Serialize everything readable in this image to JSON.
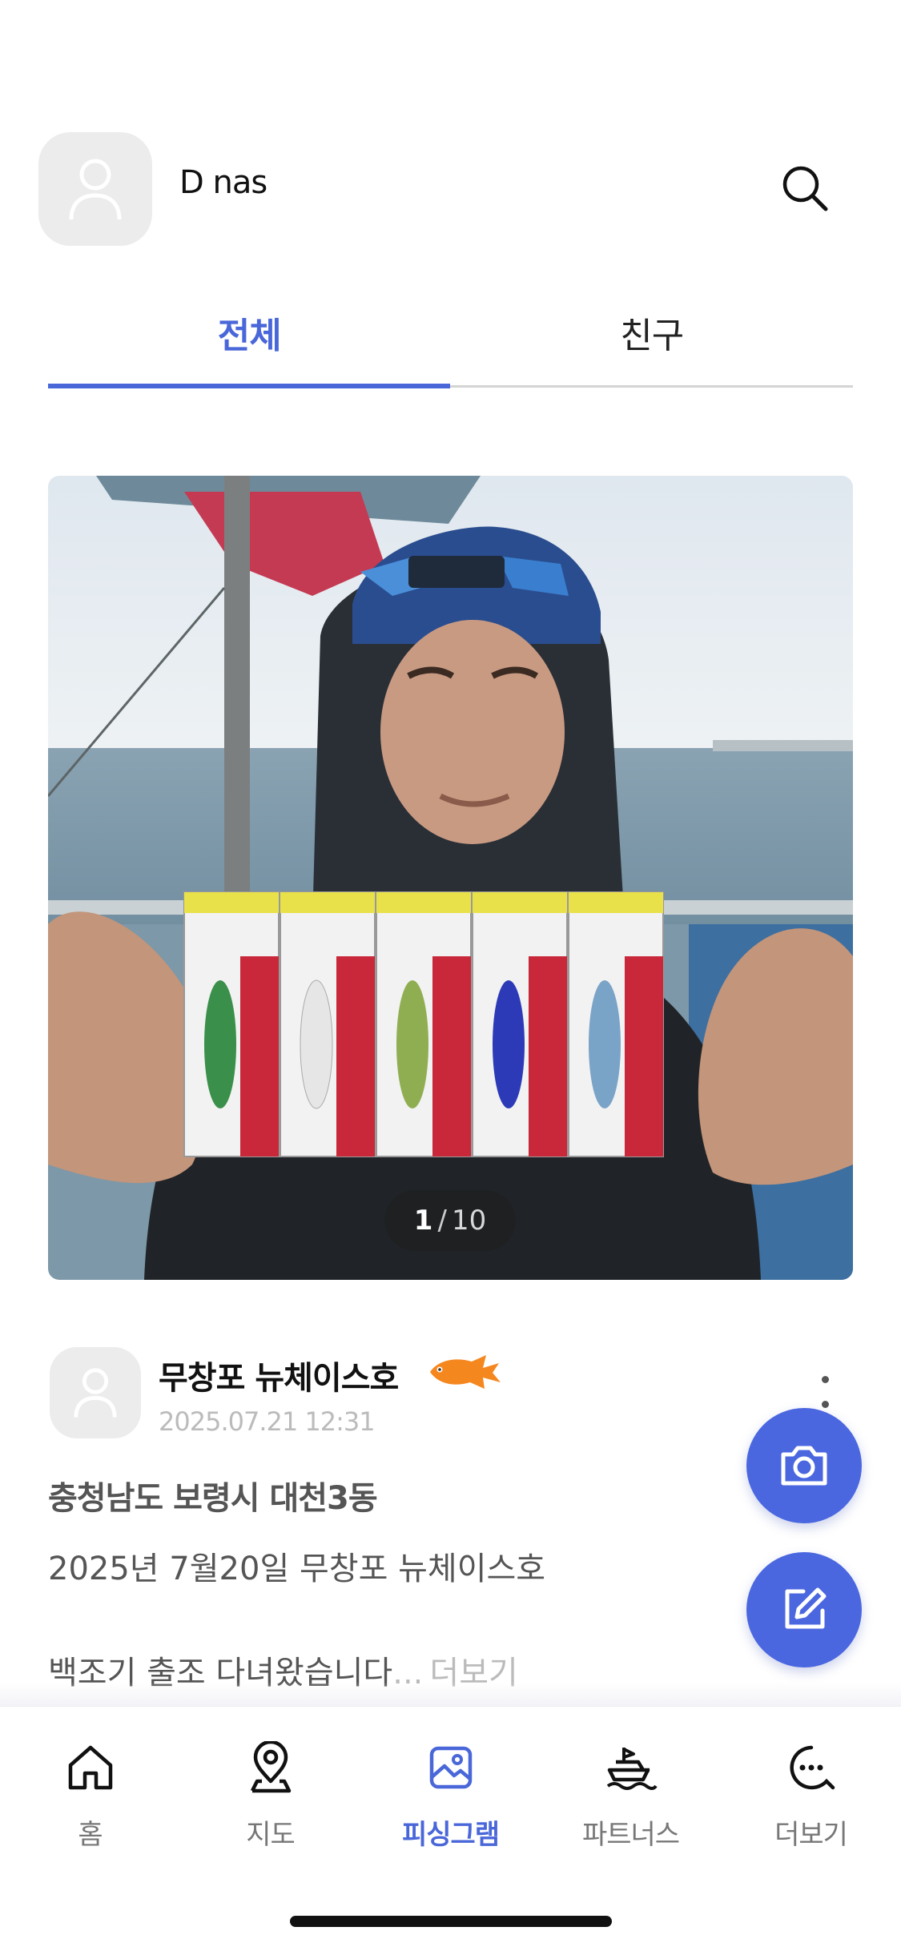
{
  "header": {
    "profile_name": "D nas"
  },
  "tabs": [
    {
      "label": "전체",
      "active": true
    },
    {
      "label": "친구",
      "active": false
    }
  ],
  "photo": {
    "current_index": "1",
    "separator": "/",
    "total": "10"
  },
  "post": {
    "author": "무창포 뉴체이스호",
    "date": "2025.07.21 12:31",
    "location": "충청남도 보령시 대천3동",
    "line1": "2025년 7월20일 무창포 뉴체이스호",
    "line2": "백조기 출조  다녀왔습니다",
    "ellipsis": "...",
    "more_label": "더보기"
  },
  "bottom_nav": [
    {
      "label": "홈",
      "icon": "home-icon",
      "active": false
    },
    {
      "label": "지도",
      "icon": "map-pin-icon",
      "active": false
    },
    {
      "label": "피싱그램",
      "icon": "image-icon",
      "active": true
    },
    {
      "label": "파트너스",
      "icon": "boat-icon",
      "active": false
    },
    {
      "label": "더보기",
      "icon": "chat-more-icon",
      "active": false
    }
  ],
  "colors": {
    "accent": "#4a67d9",
    "fab": "#4a67e0",
    "fish_badge": "#f5871f"
  }
}
